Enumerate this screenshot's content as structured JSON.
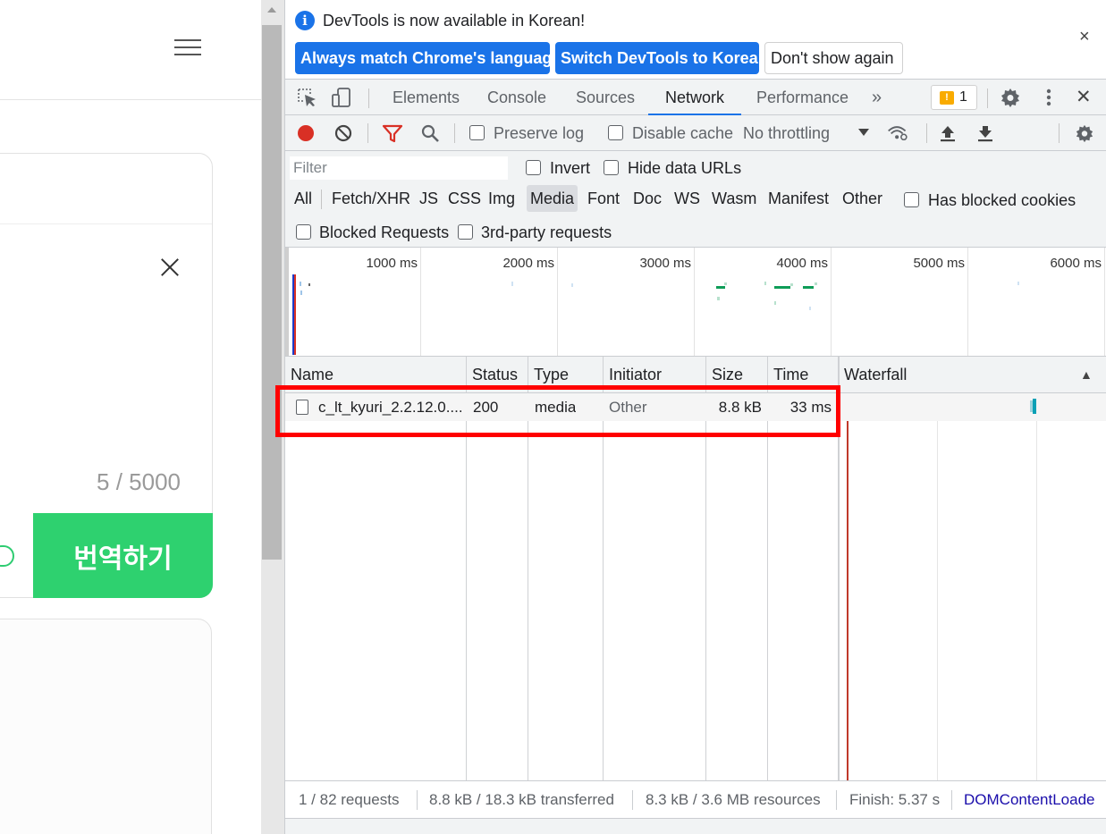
{
  "page": {
    "counter": "5 / 5000",
    "translate_button": "번역하기"
  },
  "infobar": {
    "message": "DevTools is now available in Korean!",
    "buttons": [
      "Always match Chrome's language",
      "Switch DevTools to Korean",
      "Don't show again"
    ],
    "close": "×"
  },
  "tabs": {
    "items": [
      "Elements",
      "Console",
      "Sources",
      "Network",
      "Performance"
    ],
    "active": "Network",
    "more": "»",
    "issues_count": "1",
    "close": "✕"
  },
  "network_toolbar": {
    "preserve_log": "Preserve log",
    "disable_cache": "Disable cache",
    "throttling": "No throttling"
  },
  "filter": {
    "placeholder": "Filter",
    "invert": "Invert",
    "hide_data_urls": "Hide data URLs",
    "types": [
      "All",
      "Fetch/XHR",
      "JS",
      "CSS",
      "Img",
      "Media",
      "Font",
      "Doc",
      "WS",
      "Wasm",
      "Manifest",
      "Other"
    ],
    "active_type": "Media",
    "has_blocked_cookies": "Has blocked cookies",
    "blocked_requests": "Blocked Requests",
    "third_party": "3rd-party requests"
  },
  "overview": {
    "ticks": [
      "1000 ms",
      "2000 ms",
      "3000 ms",
      "4000 ms",
      "5000 ms",
      "6000 ms"
    ]
  },
  "table": {
    "columns": [
      "Name",
      "Status",
      "Type",
      "Initiator",
      "Size",
      "Time",
      "Waterfall"
    ],
    "sort_indicator": "▲",
    "rows": [
      {
        "name": "c_lt_kyuri_2.2.12.0....",
        "status": "200",
        "type": "media",
        "initiator": "Other",
        "size": "8.8 kB",
        "time": "33 ms"
      }
    ]
  },
  "status": {
    "requests": "1 / 82 requests",
    "transferred": "8.8 kB / 18.3 kB transferred",
    "resources": "8.3 kB / 3.6 MB resources",
    "finish": "Finish: 5.37 s",
    "dcl": "DOMContentLoade"
  },
  "colors": {
    "accent": "#1a73e8",
    "record": "#d93025",
    "translate": "#2ed16f",
    "highlight": "#ff0000"
  }
}
